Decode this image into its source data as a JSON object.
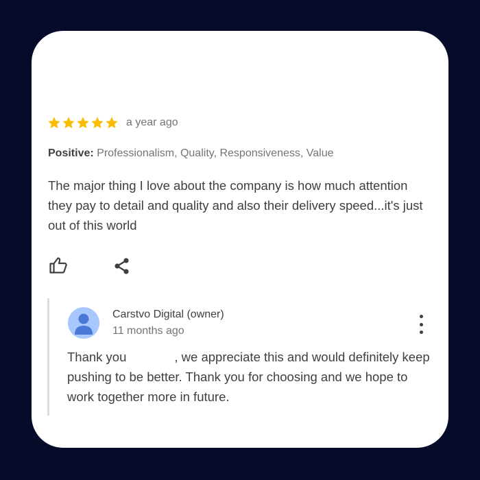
{
  "review": {
    "rating": 5,
    "rating_max": 5,
    "star_color": "#fbbc04",
    "time": "a year ago",
    "positive_label": "Positive:",
    "positive_items": "Professionalism, Quality, Responsiveness, Value",
    "text": "The major thing I love about the company is how much attention they pay to detail and quality and also their delivery speed...it's just out of this world"
  },
  "actions": {
    "like_icon": "thumbs-up-icon",
    "share_icon": "share-icon"
  },
  "reply": {
    "owner_name": "Carstvo Digital (owner)",
    "time": "11 months ago",
    "avatar_icon": "person-avatar-icon",
    "avatar_color": "#a9c7ff",
    "text_before": "Thank you",
    "text_after": ", we appreciate this and would definitely keep pushing to be better. Thank you for choosing and we hope to work together more in future.",
    "more_icon": "more-vertical-icon"
  }
}
